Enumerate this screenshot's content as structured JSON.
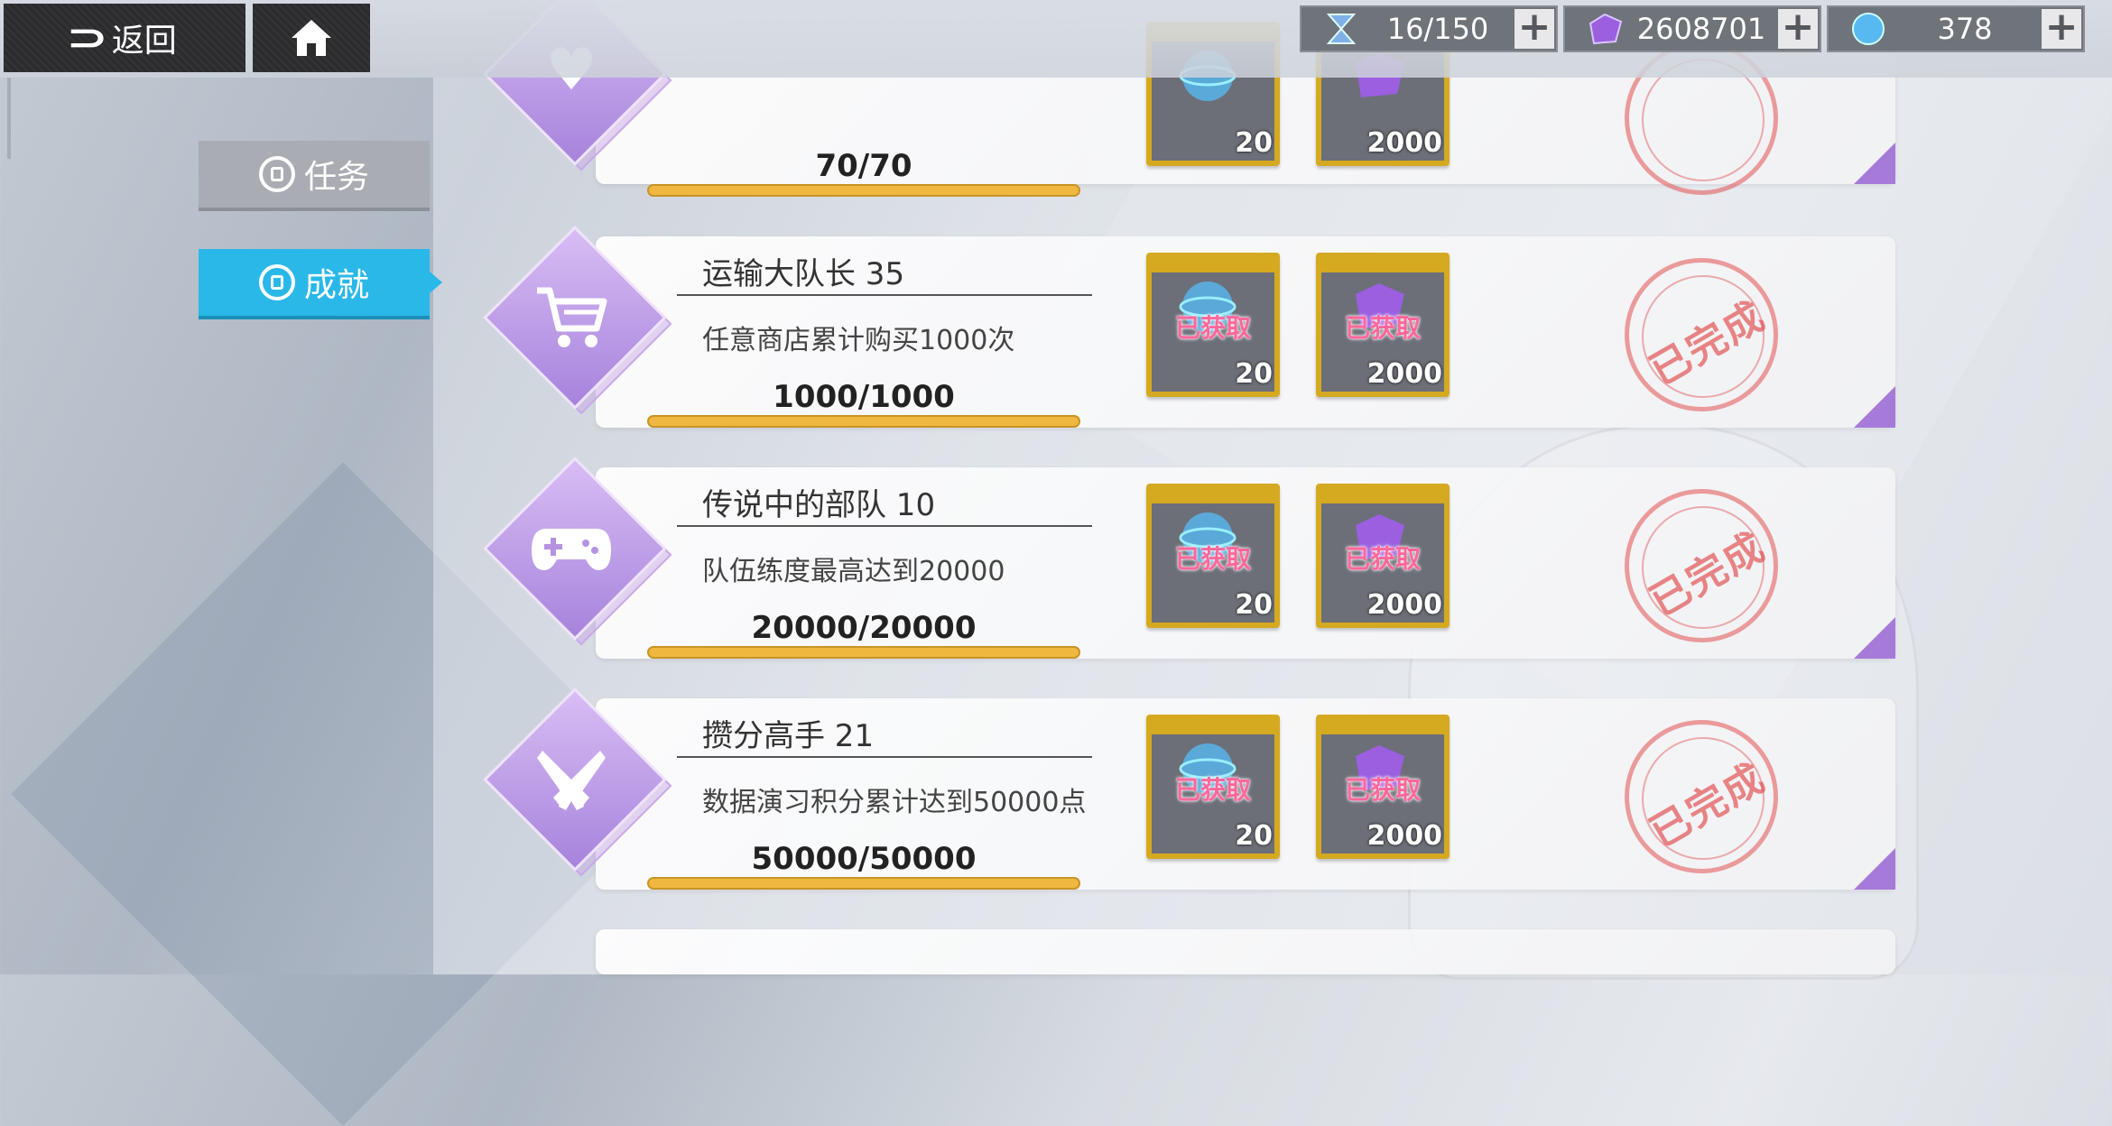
{
  "nav": {
    "back_label": "返回"
  },
  "resources": [
    {
      "name": "stamina",
      "value": "16/150",
      "icon": "hourglass-icon",
      "color": "#7fb0e8"
    },
    {
      "name": "crystal",
      "value": "2608701",
      "icon": "purple-gem-icon",
      "color": "#9b5fe0"
    },
    {
      "name": "orb",
      "value": "378",
      "icon": "blue-orb-icon",
      "color": "#58b8f0"
    }
  ],
  "tabs": {
    "task": "任务",
    "achievement": "成就"
  },
  "achievements": [
    {
      "title": "",
      "desc": "",
      "progress": "70/70",
      "icon": "heart-icon",
      "rewards": [
        {
          "count": "20",
          "status": "",
          "type": "blue-orb"
        },
        {
          "count": "2000",
          "status": "",
          "type": "purple-gem"
        }
      ],
      "stamp": ""
    },
    {
      "title": "运输大队长 35",
      "desc": "任意商店累计购买1000次",
      "progress": "1000/1000",
      "icon": "cart-icon",
      "rewards": [
        {
          "count": "20",
          "status": "已获取",
          "type": "blue-orb"
        },
        {
          "count": "2000",
          "status": "已获取",
          "type": "purple-gem"
        }
      ],
      "stamp": "已完成"
    },
    {
      "title": "传说中的部队 10",
      "desc": "队伍练度最高达到20000",
      "progress": "20000/20000",
      "icon": "gamepad-icon",
      "rewards": [
        {
          "count": "20",
          "status": "已获取",
          "type": "blue-orb"
        },
        {
          "count": "2000",
          "status": "已获取",
          "type": "purple-gem"
        }
      ],
      "stamp": "已完成"
    },
    {
      "title": "攒分高手 21",
      "desc": "数据演习积分累计达到50000点",
      "progress": "50000/50000",
      "icon": "crossed-guns-icon",
      "rewards": [
        {
          "count": "20",
          "status": "已获取",
          "type": "blue-orb"
        },
        {
          "count": "2000",
          "status": "已获取",
          "type": "purple-gem"
        }
      ],
      "stamp": "已完成"
    }
  ]
}
